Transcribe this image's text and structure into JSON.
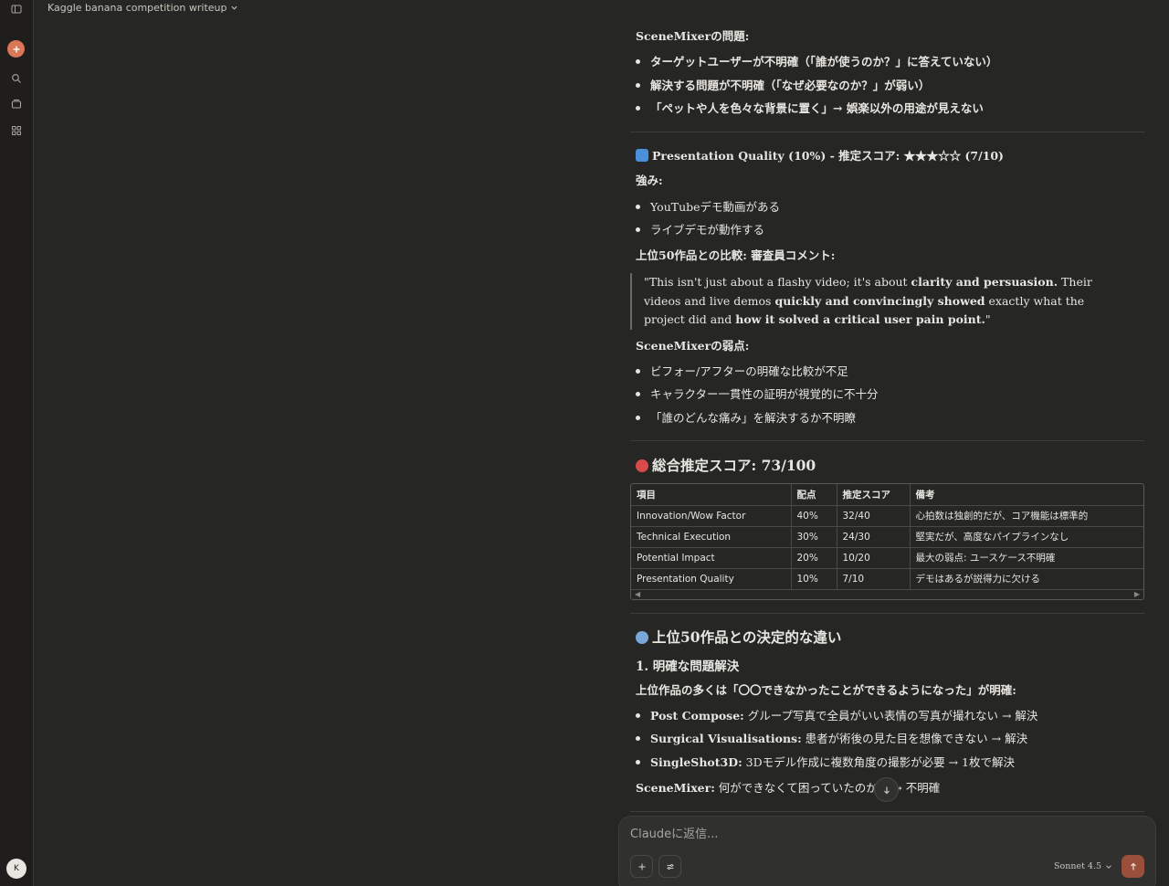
{
  "app": {
    "conversation_title": "Kaggle banana competition writeup",
    "user_initial": "K",
    "accent": "#d97757"
  },
  "sections": {
    "problems_heading": "SceneMixerの問題:",
    "problems": [
      "ターゲットユーザーが不明確（「誰が使うのか？」に答えていない）",
      "解決する問題が不明確（「なぜ必要なのか？」が弱い）",
      "「ペットや人を色々な背景に置く」→ 娯楽以外の用途が見えない"
    ],
    "presentation": {
      "heading": "Presentation Quality (10%) - 推定スコア: ★★★☆☆ (7/10)",
      "strengths_label": "強み:",
      "strengths": [
        "YouTubeデモ動画がある",
        "ライブデモが動作する"
      ],
      "compare_label": "上位50作品との比較: 審査員コメント:",
      "quote": {
        "p1": "\"This isn't just about a flashy video; it's about ",
        "b1": "clarity and persuasion.",
        "p2": " Their videos and live demos ",
        "b2": "quickly and convincingly showed",
        "p3": " exactly what the project did and ",
        "b3": "how it solved a critical user pain point.",
        "p4": "\""
      },
      "weakness_label": "SceneMixerの弱点:",
      "weaknesses": [
        "ビフォー/アフターの明確な比較が不足",
        "キャラクター一貫性の証明が視覚的に不十分",
        "「誰のどんな痛み」を解決するか不明瞭"
      ]
    },
    "total": {
      "heading": "総合推定スコア: 73/100",
      "columns": [
        "項目",
        "配点",
        "推定スコア",
        "備考"
      ],
      "rows": [
        [
          "Innovation/Wow Factor",
          "40%",
          "32/40",
          "心拍数は独創的だが、コア機能は標準的"
        ],
        [
          "Technical Execution",
          "30%",
          "24/30",
          "堅実だが、高度なパイプラインなし"
        ],
        [
          "Potential Impact",
          "20%",
          "10/20",
          "最大の弱点: ユースケース不明確"
        ],
        [
          "Presentation Quality",
          "10%",
          "7/10",
          "デモはあるが説得力に欠ける"
        ]
      ]
    },
    "diff": {
      "heading": "上位50作品との決定的な違い",
      "sub": "1. 明確な問題解決",
      "intro": "上位作品の多くは「〇〇できなかったことができるようになった」が明確:",
      "items": [
        {
          "b": "Post Compose:",
          "t": " グループ写真で全員がいい表情の写真が撮れない → 解決"
        },
        {
          "b": "Surgical Visualisations:",
          "t": " 患者が術後の見た目を想像できない → 解決"
        },
        {
          "b": "SingleShot3D:",
          "t": " 3Dモデル作成に複数角度の撮影が必要 → 1枚で解決"
        }
      ],
      "scenemixer_b": "SceneMixer:",
      "scenemixer_t": " 何ができなくて困っていたのか？ → 不明確"
    }
  },
  "composer": {
    "placeholder": "Claudeに返信...",
    "model": "Sonnet 4.5"
  }
}
